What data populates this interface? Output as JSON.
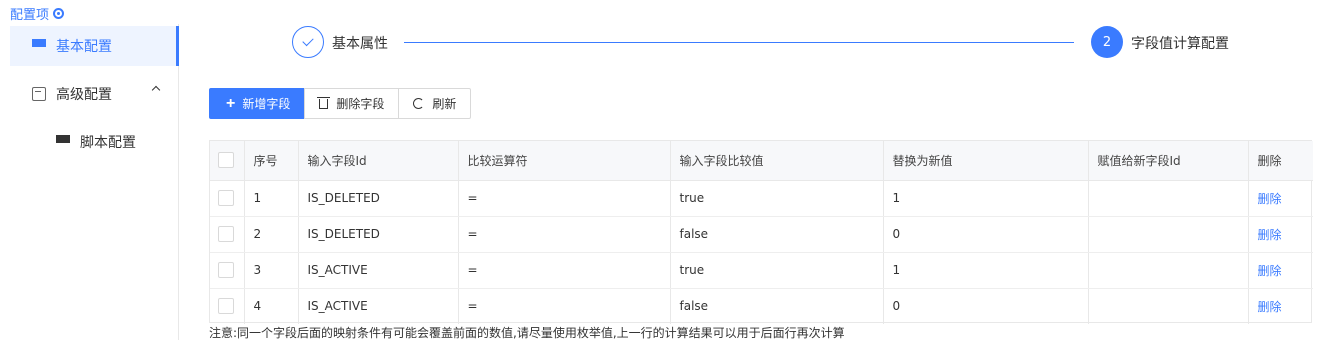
{
  "header": {
    "title": "配置项",
    "icon": "settings-target-icon",
    "accent": "#3a7bff"
  },
  "sidebar": {
    "items": [
      {
        "label": "基本配置",
        "icon": "grid-icon",
        "active": true
      },
      {
        "label": "高级配置",
        "icon": "cube-icon",
        "expanded": true
      },
      {
        "label": "脚本配置",
        "icon": "grid-icon"
      }
    ]
  },
  "steps": [
    {
      "label": "基本属性",
      "status": "done",
      "icon": "check-icon"
    },
    {
      "number": "2",
      "label": "字段值计算配置",
      "status": "current"
    }
  ],
  "toolbar": {
    "add_label": "新增字段",
    "delete_label": "删除字段",
    "refresh_label": "刷新"
  },
  "table": {
    "columns": [
      "序号",
      "输入字段Id",
      "比较运算符",
      "输入字段比较值",
      "替换为新值",
      "赋值给新字段Id",
      "删除"
    ],
    "rows": [
      {
        "index": "1",
        "field_id": "IS_DELETED",
        "operator": "=",
        "compare_value": "true",
        "new_value": "1",
        "target_field": "",
        "action": "删除"
      },
      {
        "index": "2",
        "field_id": "IS_DELETED",
        "operator": "=",
        "compare_value": "false",
        "new_value": "0",
        "target_field": "",
        "action": "删除"
      },
      {
        "index": "3",
        "field_id": "IS_ACTIVE",
        "operator": "=",
        "compare_value": "true",
        "new_value": "1",
        "target_field": "",
        "action": "删除"
      },
      {
        "index": "4",
        "field_id": "IS_ACTIVE",
        "operator": "=",
        "compare_value": "false",
        "new_value": "0",
        "target_field": "",
        "action": "删除"
      }
    ]
  },
  "note": "注意:同一个字段后面的映射条件有可能会覆盖前面的数值,请尽量使用枚举值,上一行的计算结果可以用于后面行再次计算"
}
